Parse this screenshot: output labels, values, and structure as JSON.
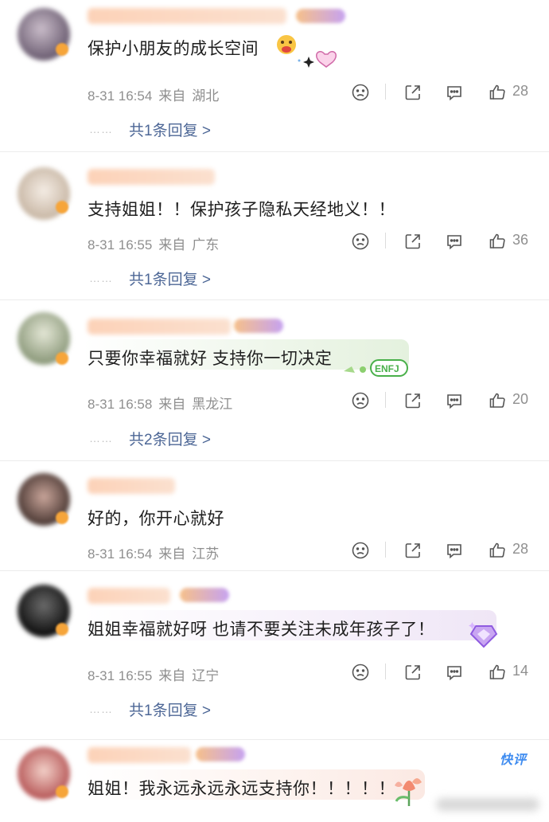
{
  "comments": [
    {
      "text": "保护小朋友的成长空间",
      "time": "8-31 16:54",
      "from": "来自",
      "location": "湖北",
      "likes": "28",
      "replies_label": "共1条回复 >",
      "avatar_color": "#8a7d8f",
      "text_bg": "#ffffff"
    },
    {
      "text": "支持姐姐！！保护孩子隐私天经地义！！",
      "time": "8-31 16:55",
      "from": "来自",
      "location": "广东",
      "likes": "36",
      "replies_label": "共1条回复 >",
      "avatar_color": "#d8cfc6",
      "text_bg": "#ffffff"
    },
    {
      "text": "只要你幸福就好  支持你一切决定",
      "time": "8-31 16:58",
      "from": "来自",
      "location": "黑龙江",
      "likes": "20",
      "replies_label": "共2条回复 >",
      "avatar_color": "#a9b49a",
      "text_bg": "#eef6ea"
    },
    {
      "text": "好的，你开心就好",
      "time": "8-31 16:54",
      "from": "来自",
      "location": "江苏",
      "likes": "28",
      "replies_label": "",
      "avatar_color": "#6e5a55",
      "text_bg": "#ffffff"
    },
    {
      "text": "姐姐幸福就好呀 也请不要关注未成年孩子了！",
      "time": "8-31 16:55",
      "from": "来自",
      "location": "辽宁",
      "likes": "14",
      "replies_label": "共1条回复 >",
      "avatar_color": "#2b2b2b",
      "text_bg": "#f5eef8"
    },
    {
      "text": "姐姐！我永远永远永远支持你！！！！！",
      "time": "",
      "from": "",
      "location": "",
      "likes": "",
      "replies_label": "",
      "avatar_color": "#c98a8a",
      "text_bg": "#fcf0ec"
    }
  ],
  "badge_label": "快评",
  "icons": {
    "dislike": "sad-face-icon",
    "share": "share-icon",
    "comment": "comment-icon",
    "like": "thumbs-up-icon"
  },
  "colors": {
    "link": "#4d6796",
    "meta": "#8f8f8f",
    "badge": "#3f8cf0"
  }
}
